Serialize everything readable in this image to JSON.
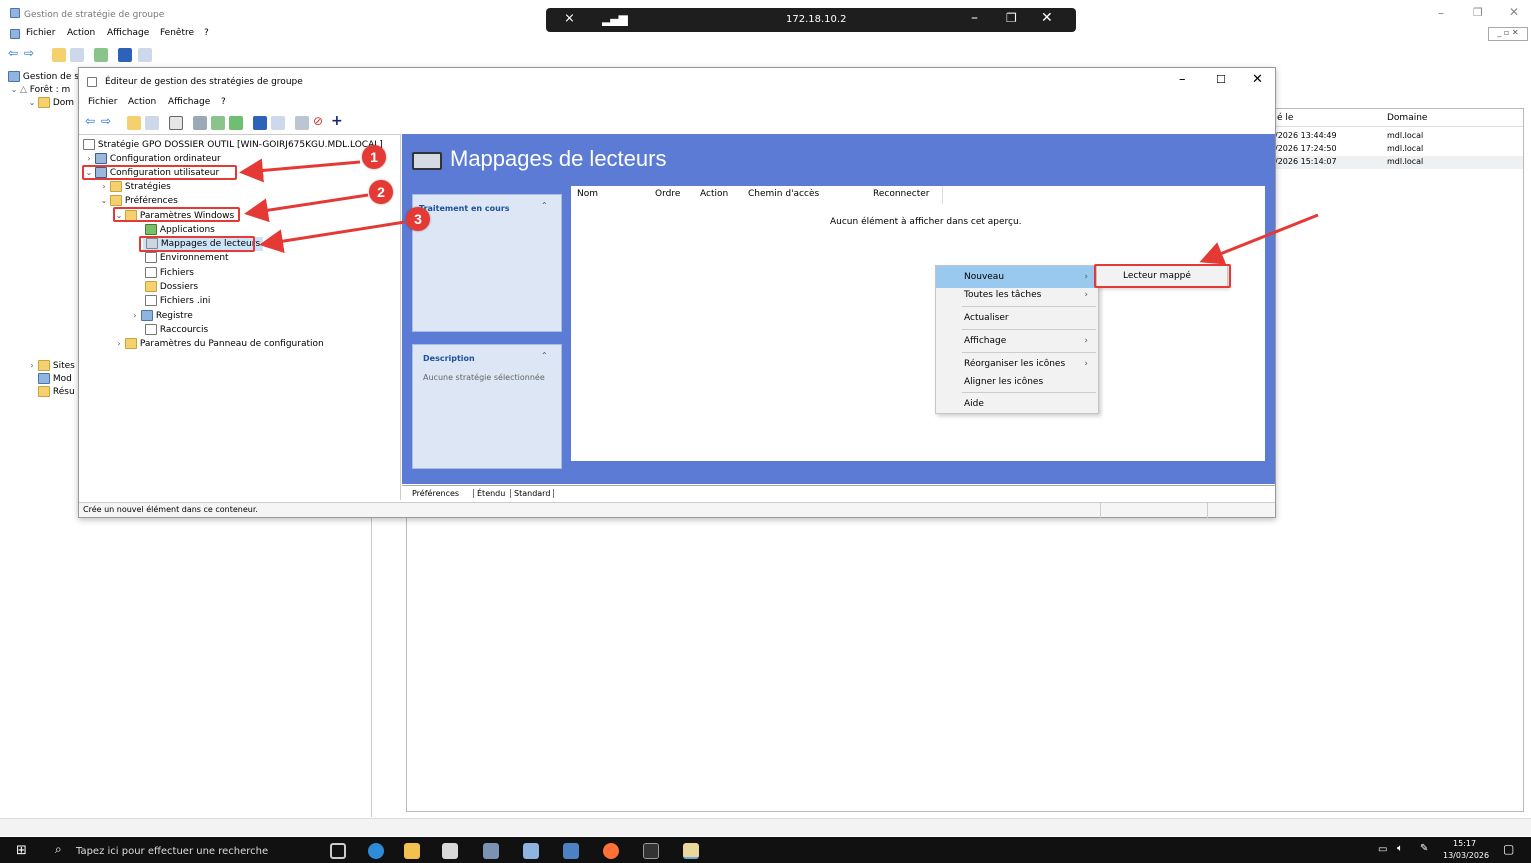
{
  "remote_bar": {
    "ip": "172.18.10.2"
  },
  "outer": {
    "title": "Gestion de stratégie de groupe",
    "menu": [
      "Fichier",
      "Action",
      "Affichage",
      "Fenêtre",
      "?"
    ],
    "tree": [
      "Gestion de s",
      "Forêt : m",
      "Dom",
      "Sites",
      "Mod",
      "Résu"
    ],
    "list_headers": [
      "é le",
      "Domaine"
    ],
    "list_rows": [
      {
        "date": "/2026 13:44:49",
        "domain": "mdl.local"
      },
      {
        "date": "/2026 17:24:50",
        "domain": "mdl.local"
      },
      {
        "date": "/2026 15:14:07",
        "domain": "mdl.local"
      }
    ]
  },
  "editor": {
    "title": "Éditeur de gestion des stratégies de groupe",
    "menu": [
      "Fichier",
      "Action",
      "Affichage",
      "?"
    ],
    "tree": {
      "root": "Stratégie GPO DOSSIER OUTIL [WIN-GOIRJ675KGU.MDL.LOCAL]",
      "computer_config": "Configuration ordinateur",
      "user_config": "Configuration utilisateur",
      "strategies": "Stratégies",
      "preferences": "Préférences",
      "windows_settings": "Paramètres Windows",
      "applications": "Applications",
      "drive_maps": "Mappages de lecteurs",
      "environment": "Environnement",
      "files": "Fichiers",
      "folders": "Dossiers",
      "ini_files": "Fichiers .ini",
      "registry": "Registre",
      "shortcuts": "Raccourcis",
      "control_panel": "Paramètres du Panneau de configuration"
    },
    "header_title": "Mappages de lecteurs",
    "processing_title": "Traitement en cours",
    "description_title": "Description",
    "description_text": "Aucune stratégie sélectionnée",
    "columns": [
      "Nom",
      "Ordre",
      "Action",
      "Chemin d'accès",
      "Reconnecter"
    ],
    "empty_text": "Aucun élément à afficher dans cet aperçu.",
    "tabs": [
      "Préférences",
      "Étendu",
      "Standard"
    ],
    "status": "Crée un nouvel élément dans ce conteneur."
  },
  "context_menu": {
    "items": [
      "Nouveau",
      "Toutes les tâches",
      "Actualiser",
      "Affichage",
      "Réorganiser les icônes",
      "Aligner les icônes",
      "Aide"
    ],
    "submenu_item": "Lecteur mappé"
  },
  "callouts": [
    "1",
    "2",
    "3"
  ],
  "taskbar": {
    "search_placeholder": "Tapez ici pour effectuer une recherche",
    "time": "15:17",
    "date": "13/03/2026"
  },
  "colors": {
    "accent_blue": "#5b7bd5",
    "callout_red": "#e53935",
    "menu_highlight": "#99c9ef"
  }
}
